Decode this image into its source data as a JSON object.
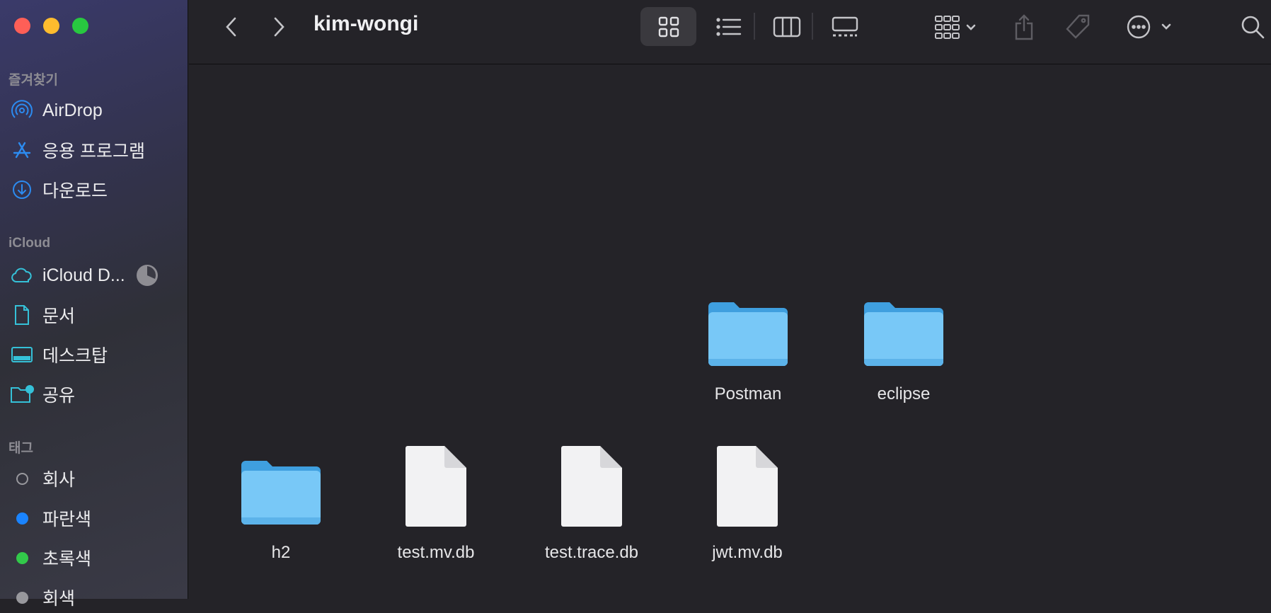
{
  "window": {
    "title": "kim-wongi"
  },
  "sidebar": {
    "favorites_header": "즐겨찾기",
    "favorites": [
      {
        "label": "AirDrop",
        "icon": "airdrop-icon"
      },
      {
        "label": "응용 프로그램",
        "icon": "applications-icon"
      },
      {
        "label": "다운로드",
        "icon": "downloads-icon"
      }
    ],
    "icloud_header": "iCloud",
    "icloud": [
      {
        "label": "iCloud D...",
        "icon": "icloud-icon"
      },
      {
        "label": "문서",
        "icon": "document-icon"
      },
      {
        "label": "데스크탑",
        "icon": "desktop-icon"
      },
      {
        "label": "공유",
        "icon": "shared-folder-icon"
      }
    ],
    "tags_header": "태그",
    "tags": [
      {
        "label": "회사",
        "color": ""
      },
      {
        "label": "파란색",
        "color": "#1a84ff"
      },
      {
        "label": "초록색",
        "color": "#32c94a"
      },
      {
        "label": "회색",
        "color": "#98989d"
      }
    ]
  },
  "toolbar": {
    "buttons": [
      "back-icon",
      "forward-icon",
      "icon-view-icon",
      "list-view-icon",
      "column-view-icon",
      "gallery-view-icon",
      "group-icon",
      "share-icon",
      "tag-icon",
      "more-icon",
      "search-icon"
    ]
  },
  "files": [
    {
      "name": "Postman",
      "kind": "folder"
    },
    {
      "name": "eclipse",
      "kind": "folder"
    },
    {
      "name": "h2",
      "kind": "folder"
    },
    {
      "name": "test.mv.db",
      "kind": "file"
    },
    {
      "name": "test.trace.db",
      "kind": "file"
    },
    {
      "name": "jwt.mv.db",
      "kind": "file"
    }
  ],
  "colors": {
    "accent": "#2c8bf0",
    "folder": "#6cc3f5"
  }
}
